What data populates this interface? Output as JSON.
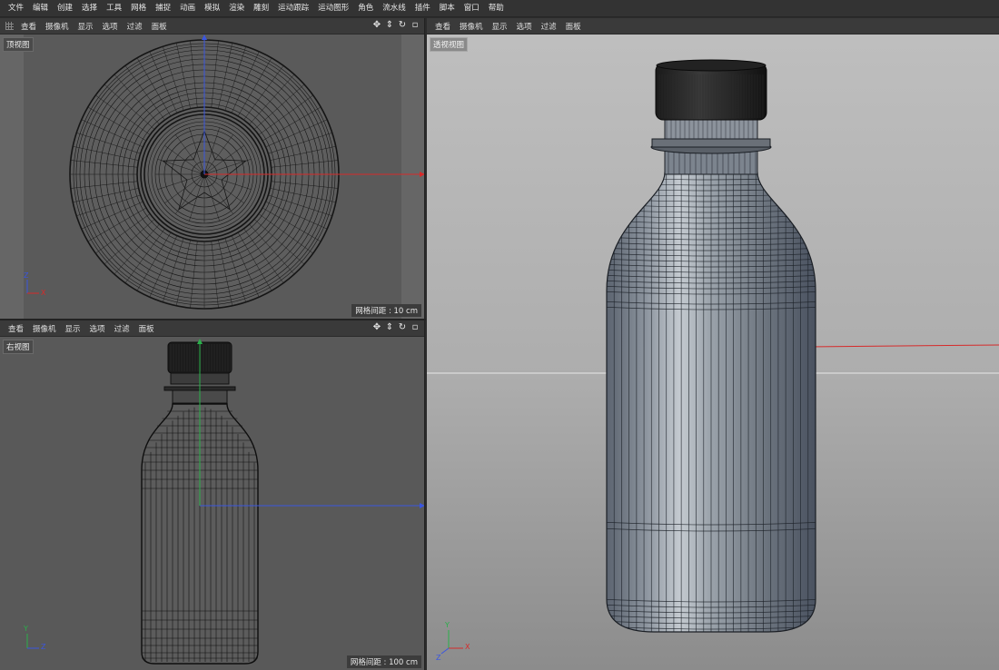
{
  "menu": [
    "文件",
    "编辑",
    "创建",
    "选择",
    "工具",
    "网格",
    "捕捉",
    "动画",
    "模拟",
    "渲染",
    "雕刻",
    "运动跟踪",
    "运动图形",
    "角色",
    "流水线",
    "插件",
    "脚本",
    "窗口",
    "帮助"
  ],
  "viewport_menu": [
    "查看",
    "摄像机",
    "显示",
    "选项",
    "过滤",
    "面板"
  ],
  "nav_icons": [
    "move-icon",
    "zoom-icon",
    "rotate-icon",
    "maximize-icon"
  ],
  "viewports": {
    "top": {
      "label": "顶视图",
      "grid": "网格间距 : 10 cm",
      "axis_a": "Z",
      "axis_b": "X"
    },
    "right": {
      "label": "右视图",
      "grid": "网格间距 : 100 cm",
      "axis_a": "Y",
      "axis_b": "Z"
    },
    "perspective": {
      "label": "透视视图",
      "axis_a": "Y",
      "axis_b": "X",
      "axis_c": "Z"
    }
  },
  "colors": {
    "x_axis": "#d62a2a",
    "y_axis": "#2ab04a",
    "z_axis": "#3a56e0",
    "menubar": "#333333",
    "viewport_bg": "#595959"
  }
}
